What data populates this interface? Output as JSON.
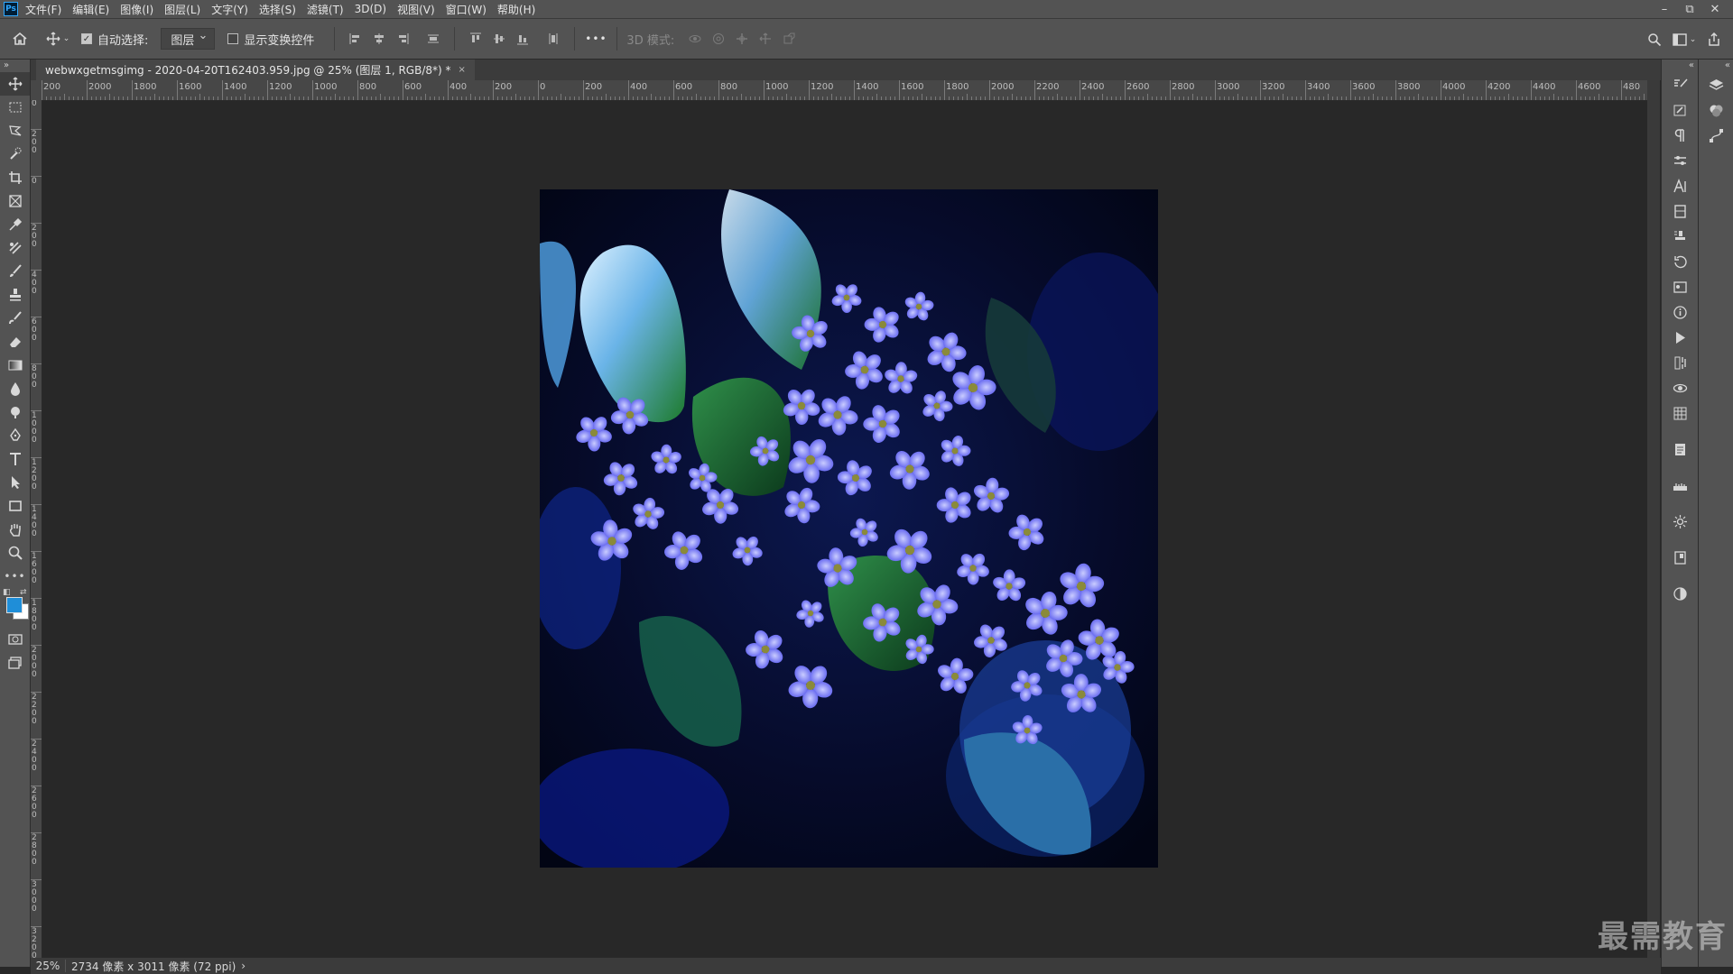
{
  "app": {
    "logo": "Ps"
  },
  "menu": [
    "文件(F)",
    "编辑(E)",
    "图像(I)",
    "图层(L)",
    "文字(Y)",
    "选择(S)",
    "滤镜(T)",
    "3D(D)",
    "视图(V)",
    "窗口(W)",
    "帮助(H)"
  ],
  "window_controls": {
    "minimize": "–",
    "restore": "⧉",
    "close": "✕"
  },
  "options_bar": {
    "auto_select_label": "自动选择:",
    "auto_select_checked": true,
    "auto_select_value": "图层",
    "show_transform_label": "显示变换控件",
    "show_transform_checked": false,
    "more": "•••",
    "mode_3d_label": "3D 模式:"
  },
  "document_tab": {
    "title": "webwxgetmsgimg - 2020-04-20T162403.959.jpg @ 25% (图层 1, RGB/8*) *",
    "close": "×"
  },
  "ruler_top_labels": [
    "200",
    "2000",
    "1800",
    "1600",
    "1400",
    "1200",
    "1000",
    "800",
    "600",
    "400",
    "200",
    "0",
    "200",
    "400",
    "600",
    "800",
    "1000",
    "1200",
    "1400",
    "1600",
    "1800",
    "2000",
    "2200",
    "2400",
    "2600",
    "2800",
    "3000",
    "3200",
    "3400",
    "3600",
    "3800",
    "4000",
    "4200",
    "4400",
    "4600",
    "480"
  ],
  "ruler_left_labels": [
    "4\n0\n0",
    "2\n0\n0",
    "0",
    "2\n0\n0",
    "4\n0\n0",
    "6\n0\n0",
    "8\n0\n0",
    "1\n0\n0\n0",
    "1\n2\n0\n0",
    "1\n4\n0\n0",
    "1\n6\n0\n0",
    "1\n8\n0\n0",
    "2\n0\n0\n0",
    "2\n2\n0\n0",
    "2\n4\n0\n0",
    "2\n6\n0\n0",
    "2\n8\n0\n0",
    "3\n0\n0\n0",
    "3\n2\n0\n0"
  ],
  "status": {
    "zoom": "25%",
    "doc_info": "2734 像素 x 3011 像素 (72 ppi)",
    "arrow": "›"
  },
  "colors": {
    "foreground": "#1f8ed8",
    "background": "#ffffff",
    "accent": "#31a8ff"
  },
  "watermark": "最需教育",
  "tools": [
    "move-tool-icon",
    "marquee-tool-icon",
    "lasso-tool-icon",
    "quick-select-tool-icon",
    "crop-tool-icon",
    "frame-tool-icon",
    "eyedropper-tool-icon",
    "healing-tool-icon",
    "brush-tool-icon",
    "stamp-tool-icon",
    "history-brush-icon",
    "eraser-tool-icon",
    "gradient-tool-icon",
    "blur-tool-icon",
    "dodge-tool-icon",
    "pen-tool-icon",
    "type-tool-icon",
    "path-select-tool-icon",
    "rectangle-tool-icon",
    "hand-tool-icon",
    "zoom-tool-icon",
    "more-tools-icon"
  ]
}
